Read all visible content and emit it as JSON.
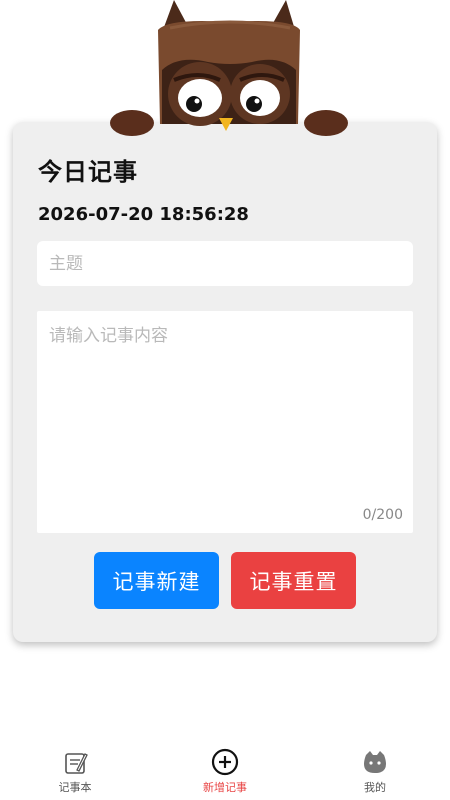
{
  "form": {
    "title": "今日记事",
    "datetime": "2026-07-20 18:56:28",
    "subject_placeholder": "主题",
    "content_placeholder": "请输入记事内容",
    "char_count": "0/200",
    "create_label": "记事新建",
    "reset_label": "记事重置"
  },
  "colors": {
    "create_button": "#0a84ff",
    "reset_button": "#ea4141",
    "active_tab": "#e84545",
    "card_background": "#efefef"
  },
  "tabbar": {
    "items": [
      {
        "label": "记事本",
        "icon": "notebook-icon",
        "active": false
      },
      {
        "label": "新增记事",
        "icon": "plus-circle-icon",
        "active": true
      },
      {
        "label": "我的",
        "icon": "profile-icon",
        "active": false
      }
    ]
  }
}
